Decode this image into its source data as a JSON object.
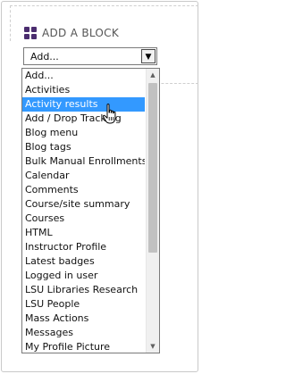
{
  "block": {
    "title": "ADD A BLOCK"
  },
  "select": {
    "value": "Add...",
    "arrow_glyph": "▼"
  },
  "dropdown": {
    "options": [
      "Add...",
      "Activities",
      "Activity results",
      "Add / Drop Tracking",
      "Blog menu",
      "Blog tags",
      "Bulk Manual Enrollments",
      "Calendar",
      "Comments",
      "Course/site summary",
      "Courses",
      "HTML",
      "Instructor Profile",
      "Latest badges",
      "Logged in user",
      "LSU Libraries Research",
      "LSU People",
      "Mass Actions",
      "Messages",
      "My Profile Picture"
    ],
    "selected_index": 2,
    "scroll_up_glyph": "▲",
    "scroll_down_glyph": "▼"
  },
  "colors": {
    "accent_icon": "#4b2d6f",
    "selection": "#3399ff"
  }
}
